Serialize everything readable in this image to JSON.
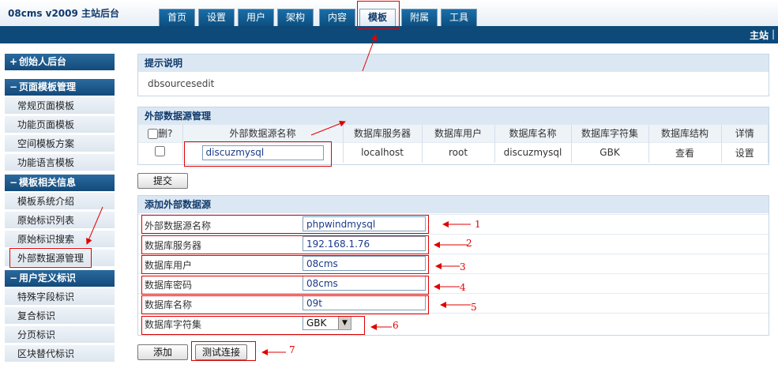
{
  "header": {
    "brand": "08cms v2009 主站后台",
    "tabs": [
      "首页",
      "设置",
      "用户",
      "架构",
      "内容",
      "模板",
      "附属",
      "工具"
    ],
    "active_tab": "模板",
    "site_link": "主站",
    "site_sep": "|"
  },
  "sidebar": {
    "founder": "创始人后台",
    "section1": "页面模板管理",
    "section1_items": [
      "常规页面模板",
      "功能页面模板",
      "空间模板方案",
      "功能语言模板"
    ],
    "section2": "模板相关信息",
    "section2_items": [
      "模板系统介绍",
      "原始标识列表",
      "原始标识搜索",
      "外部数据源管理"
    ],
    "section3": "用户定义标识",
    "section3_items": [
      "特殊字段标识",
      "复合标识",
      "分页标识",
      "区块替代标识"
    ]
  },
  "hint": {
    "title": "提示说明",
    "text": "dbsourcesedit"
  },
  "sources": {
    "title": "外部数据源管理",
    "columns": [
      "删?",
      "外部数据源名称",
      "数据库服务器",
      "数据库用户",
      "数据库名称",
      "数据库字符集",
      "数据库结构",
      "详情"
    ],
    "row": {
      "name": "discuzmysql",
      "server": "localhost",
      "user": "root",
      "dbname": "discuzmysql",
      "charset": "GBK",
      "structure": "查看",
      "detail": "设置"
    },
    "submit": "提交"
  },
  "add_form": {
    "title": "添加外部数据源",
    "fields": [
      {
        "label": "外部数据源名称",
        "value": "phpwindmysql",
        "marker": "1"
      },
      {
        "label": "数据库服务器",
        "value": "192.168.1.76",
        "marker": "2"
      },
      {
        "label": "数据库用户",
        "value": "08cms",
        "marker": "3"
      },
      {
        "label": "数据库密码",
        "value": "08cms",
        "marker": "4"
      },
      {
        "label": "数据库名称",
        "value": "09t",
        "marker": "5"
      }
    ],
    "charset_label": "数据库字符集",
    "charset_value": "GBK",
    "charset_marker": "6",
    "add_button": "添加",
    "test_button": "测试连接",
    "test_marker": "7"
  },
  "colors": {
    "nav_bar": "#0d4a7a",
    "panel_head": "#dbe8f3",
    "annotation": "#e00000"
  }
}
